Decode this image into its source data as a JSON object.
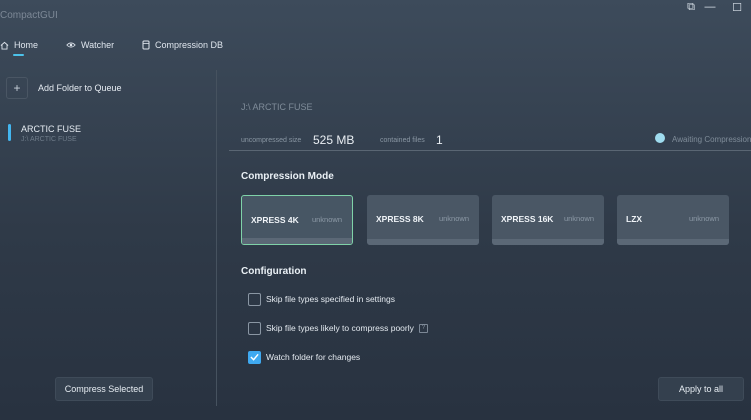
{
  "app": {
    "title": "CompactGUI"
  },
  "window_controls": {
    "snap_icon": "⧉",
    "minimize_icon": "—",
    "maximize_icon": "☐"
  },
  "nav": {
    "items": [
      {
        "label": "Home",
        "icon": "home-icon"
      },
      {
        "label": "Watcher",
        "icon": "eye-icon"
      },
      {
        "label": "Compression DB",
        "icon": "database-icon"
      }
    ],
    "active": "Home"
  },
  "queue": {
    "add_label": "Add Folder to Queue",
    "add_icon": "+",
    "items": [
      {
        "name": "ARCTIC FUSE",
        "path": "J:\\ ARCTIC FUSE"
      }
    ],
    "compress_label": "Compress Selected"
  },
  "details": {
    "path": "J:\\ ARCTIC FUSE",
    "uncompressed_label": "uncompressed size",
    "uncompressed_value": "525 MB",
    "files_label": "contained files",
    "files_value": "1",
    "status_text": "Awaiting Compression"
  },
  "compression_mode": {
    "title": "Compression Mode",
    "modes": [
      {
        "name": "XPRESS 4K",
        "estimate": "unknown",
        "selected": true
      },
      {
        "name": "XPRESS 8K",
        "estimate": "unknown",
        "selected": false
      },
      {
        "name": "XPRESS 16K",
        "estimate": "unknown",
        "selected": false
      },
      {
        "name": "LZX",
        "estimate": "unknown",
        "selected": false
      }
    ]
  },
  "configuration": {
    "title": "Configuration",
    "options": [
      {
        "label": "Skip file types specified in settings",
        "checked": false
      },
      {
        "label": "Skip file types likely to compress poorly",
        "checked": false,
        "help": "?"
      },
      {
        "label": "Watch folder for changes",
        "checked": true
      }
    ],
    "apply_label": "Apply to all"
  },
  "colors": {
    "accent": "#43b6f0",
    "selected_border": "#7fd2a8",
    "status_dot": "#9fdcef"
  }
}
